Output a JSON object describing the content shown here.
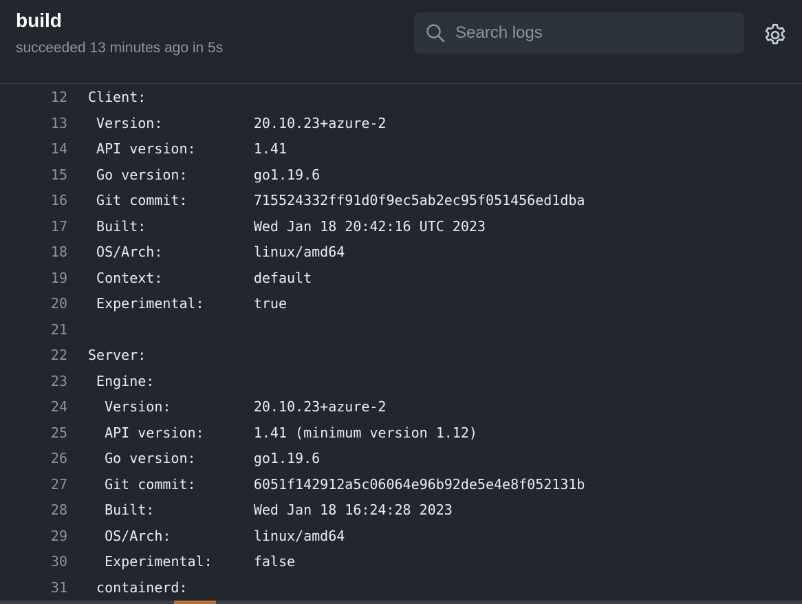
{
  "header": {
    "title": "build",
    "status": "succeeded 13 minutes ago in 5s"
  },
  "search": {
    "placeholder": "Search logs",
    "icon": "search-icon"
  },
  "settings": {
    "icon": "gear-icon"
  },
  "log": {
    "lines": [
      {
        "num": "12",
        "text": "Client:"
      },
      {
        "num": "13",
        "text": " Version:           20.10.23+azure-2"
      },
      {
        "num": "14",
        "text": " API version:       1.41"
      },
      {
        "num": "15",
        "text": " Go version:        go1.19.6"
      },
      {
        "num": "16",
        "text": " Git commit:        715524332ff91d0f9ec5ab2ec95f051456ed1dba"
      },
      {
        "num": "17",
        "text": " Built:             Wed Jan 18 20:42:16 UTC 2023"
      },
      {
        "num": "18",
        "text": " OS/Arch:           linux/amd64"
      },
      {
        "num": "19",
        "text": " Context:           default"
      },
      {
        "num": "20",
        "text": " Experimental:      true"
      },
      {
        "num": "21",
        "text": ""
      },
      {
        "num": "22",
        "text": "Server:"
      },
      {
        "num": "23",
        "text": " Engine:"
      },
      {
        "num": "24",
        "text": "  Version:          20.10.23+azure-2"
      },
      {
        "num": "25",
        "text": "  API version:      1.41 (minimum version 1.12)"
      },
      {
        "num": "26",
        "text": "  Go version:       go1.19.6"
      },
      {
        "num": "27",
        "text": "  Git commit:       6051f142912a5c06064e96b92de5e4e8f052131b"
      },
      {
        "num": "28",
        "text": "  Built:            Wed Jan 18 16:24:28 2023"
      },
      {
        "num": "29",
        "text": "  OS/Arch:          linux/amd64"
      },
      {
        "num": "30",
        "text": "  Experimental:     false"
      },
      {
        "num": "31",
        "text": " containerd:"
      }
    ]
  },
  "colors": {
    "background": "#22272e",
    "search_bg": "#2d333b",
    "line_number": "#8b949e",
    "scroll_thumb": "#b8713a"
  }
}
